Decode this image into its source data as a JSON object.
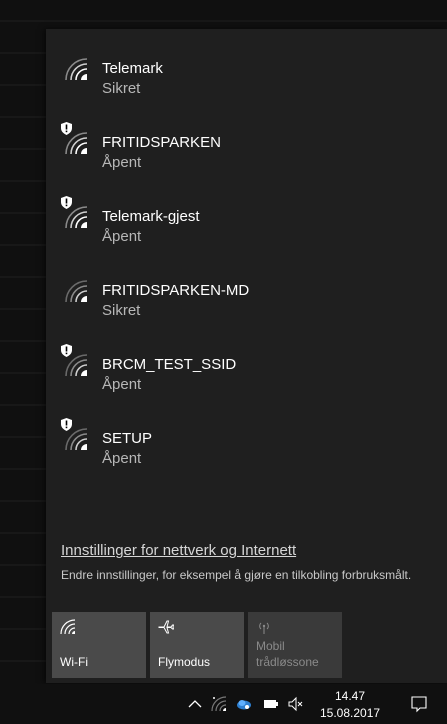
{
  "networks": [
    {
      "name": "Telemark",
      "status": "Sikret",
      "secured": true
    },
    {
      "name": "FRITIDSPARKEN",
      "status": "Åpent",
      "secured": false
    },
    {
      "name": "Telemark-gjest",
      "status": "Åpent",
      "secured": false
    },
    {
      "name": "FRITIDSPARKEN-MD",
      "status": "Sikret",
      "secured": true
    },
    {
      "name": "BRCM_TEST_SSID",
      "status": "Åpent",
      "secured": false
    },
    {
      "name": "SETUP",
      "status": "Åpent",
      "secured": false
    }
  ],
  "settings": {
    "link": "Innstillinger for nettverk og Internett",
    "description": "Endre innstillinger, for eksempel å gjøre en tilkobling forbruksmålt."
  },
  "quick_actions": [
    {
      "label": "Wi-Fi",
      "icon": "wifi-icon",
      "enabled": true
    },
    {
      "label": "Flymodus",
      "icon": "airplane-icon",
      "enabled": true
    },
    {
      "label": "Mobil trådløssone",
      "icon": "mobile-hotspot-icon",
      "enabled": false
    }
  ],
  "taskbar": {
    "time": "14.47",
    "date": "15.08.2017",
    "tray_icons": [
      "chevron-up-icon",
      "wifi-icon",
      "network-cloud-icon",
      "battery-icon",
      "volume-muted-icon"
    ],
    "action_center_icon": "action-center-icon"
  },
  "colors": {
    "flyout_bg": "#1f1f1f",
    "tile_bg": "#4a4a4a",
    "tile_disabled_bg": "#3a3a3a",
    "taskbar_bg": "#101010"
  }
}
